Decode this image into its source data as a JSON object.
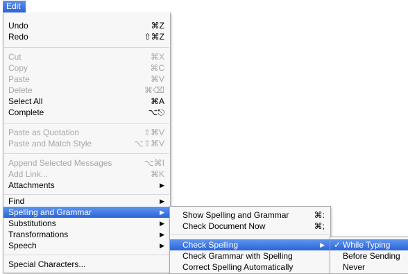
{
  "menu_title": "Edit",
  "main_menu": [
    {
      "label": "Undo",
      "shortcut": "⌘Z",
      "enabled": true
    },
    {
      "label": "Redo",
      "shortcut": "⇧⌘Z",
      "enabled": true
    },
    {
      "label": "Cut",
      "shortcut": "⌘X",
      "enabled": false
    },
    {
      "label": "Copy",
      "shortcut": "⌘C",
      "enabled": false
    },
    {
      "label": "Paste",
      "shortcut": "⌘V",
      "enabled": false
    },
    {
      "label": "Delete",
      "shortcut": "⌘⌫",
      "enabled": false
    },
    {
      "label": "Select All",
      "shortcut": "⌘A",
      "enabled": true
    },
    {
      "label": "Complete",
      "shortcut": "⌥⎋",
      "enabled": true
    },
    {
      "label": "Paste as Quotation",
      "shortcut": "⇧⌘V",
      "enabled": false
    },
    {
      "label": "Paste and Match Style",
      "shortcut": "⌥⇧⌘V",
      "enabled": false
    },
    {
      "label": "Append Selected Messages",
      "shortcut": "⌥⌘I",
      "enabled": false
    },
    {
      "label": "Add Link...",
      "shortcut": "⌘K",
      "enabled": false
    },
    {
      "label": "Attachments",
      "submenu": true,
      "enabled": true
    },
    {
      "label": "Find",
      "submenu": true,
      "enabled": true
    },
    {
      "label": "Spelling and Grammar",
      "submenu": true,
      "enabled": true,
      "highlighted": true
    },
    {
      "label": "Substitutions",
      "submenu": true,
      "enabled": true
    },
    {
      "label": "Transformations",
      "submenu": true,
      "enabled": true
    },
    {
      "label": "Speech",
      "submenu": true,
      "enabled": true
    },
    {
      "label": "Special Characters...",
      "enabled": true
    }
  ],
  "spelling_submenu": [
    {
      "label": "Show Spelling and Grammar",
      "shortcut": "⌘:"
    },
    {
      "label": "Check Document Now",
      "shortcut": "⌘;"
    },
    {
      "label": "Check Spelling",
      "submenu": true,
      "highlighted": true
    },
    {
      "label": "Check Grammar with Spelling"
    },
    {
      "label": "Correct Spelling Automatically"
    }
  ],
  "check_spelling_submenu": [
    {
      "label": "While Typing",
      "checked": true,
      "highlighted": true
    },
    {
      "label": "Before Sending"
    },
    {
      "label": "Never"
    }
  ],
  "glyphs": {
    "submenu_arrow": "▶",
    "checkmark": "✓"
  }
}
